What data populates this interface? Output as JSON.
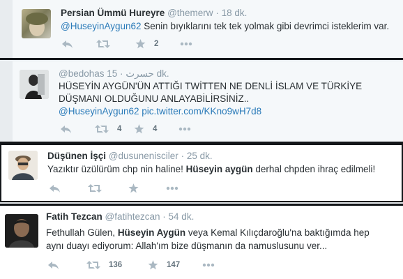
{
  "tweets": [
    {
      "name": "Persian Ümmü Hureyre",
      "handle": "@themerw",
      "time": "· 18 dk.",
      "lines": [
        {
          "mention": "@HuseyinAygun62",
          "text": " Senin bıyıklarını tek tek yolmak gibi devrimci isteklerim var."
        }
      ],
      "retweets": "",
      "favorites": "2"
    },
    {
      "name": "",
      "handle": "@bedohas حسرت",
      "time": "· 15 dk.",
      "lines": [
        {
          "text": "HÜSEYİN AYGÜN'ÜN ATTIĞI TWİTTEN NE DENLİ İSLAM VE TÜRKİYE"
        },
        {
          "text": "DÜŞMANI OLDUĞUNU ANLAYABİLİRSİNİZ.."
        },
        {
          "mention": "@HuseyinAygun62",
          "link": " pic.twitter.com/KKno9wH7d8"
        }
      ],
      "retweets": "4",
      "favorites": "4"
    },
    {
      "name": "Düşünen İşçi",
      "handle": "@dusuneniscil̇er",
      "time": "· 25 dk.",
      "lines": [
        {
          "pre": "Yazıktır üzülürüm chp nin haline! ",
          "bold": "Hüseyin aygün",
          "post": " derhal chpden ihraç edilmeli!"
        }
      ],
      "retweets": "",
      "favorites": ""
    },
    {
      "name": "Fatih Tezcan",
      "handle": "@fatihtezcan",
      "time": "· 54 dk.",
      "lines": [
        {
          "pre": "Fethullah Gülen, ",
          "bold": "Hüseyin Aygün",
          "post": " veya Kemal Kılıçdaroğlu'na baktığımda hep"
        },
        {
          "text": "aynı duayı ediyorum: Allah'ım bize düşmanın da namuslusunu ver..."
        }
      ],
      "retweets": "136",
      "favorites": "147"
    }
  ],
  "icons": [
    "reply-icon",
    "retweet-icon",
    "favorite-star-icon",
    "more-dots-icon"
  ]
}
